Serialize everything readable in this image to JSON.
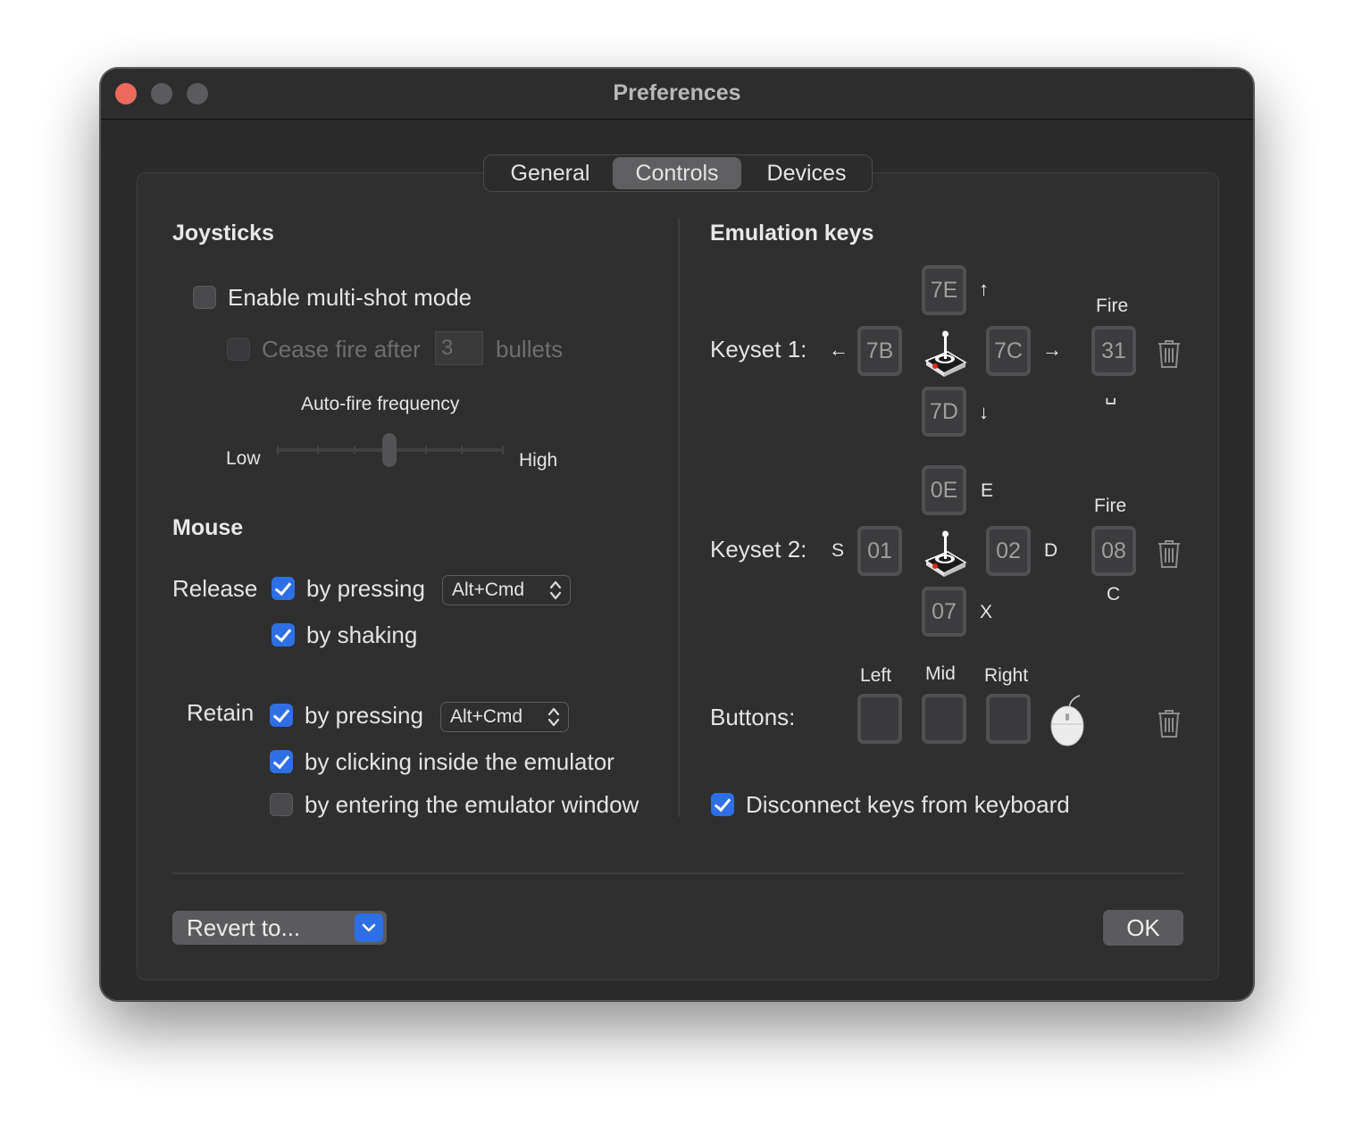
{
  "window": {
    "title": "Preferences"
  },
  "tabs": [
    {
      "label": "General",
      "selected": false
    },
    {
      "label": "Controls",
      "selected": true
    },
    {
      "label": "Devices",
      "selected": false
    }
  ],
  "joysticks": {
    "heading": "Joysticks",
    "multishot_label": "Enable multi-shot mode",
    "multishot_checked": false,
    "cease_fire_label": "Cease fire after",
    "cease_fire_value": "3",
    "bullets_label": "bullets",
    "autofire_label": "Auto-fire frequency",
    "low_label": "Low",
    "high_label": "High",
    "autofire_level_fraction": 0.5
  },
  "mouse": {
    "heading": "Mouse",
    "release_label": "Release",
    "release_pressing_label": "by pressing",
    "release_pressing_checked": true,
    "release_key": "Alt+Cmd",
    "release_shaking_label": "by shaking",
    "release_shaking_checked": true,
    "retain_label": "Retain",
    "retain_pressing_label": "by pressing",
    "retain_pressing_checked": true,
    "retain_key": "Alt+Cmd",
    "retain_clicking_label": "by clicking inside the emulator",
    "retain_clicking_checked": true,
    "retain_entering_label": "by entering the emulator window",
    "retain_entering_checked": false
  },
  "emulation": {
    "heading": "Emulation keys",
    "keyset1": {
      "label": "Keyset 1:",
      "up": "7E",
      "up_symbol": "↑",
      "left": "7B",
      "left_symbol": "←",
      "right": "7C",
      "right_symbol": "→",
      "down": "7D",
      "down_symbol": "↓",
      "fire_label": "Fire",
      "fire": "31",
      "fire_symbol": "␣"
    },
    "keyset2": {
      "label": "Keyset 2:",
      "up": "0E",
      "up_symbol": "E",
      "left": "01",
      "left_symbol": "S",
      "right": "02",
      "right_symbol": "D",
      "down": "07",
      "down_symbol": "X",
      "fire_label": "Fire",
      "fire": "08",
      "fire_symbol": "C"
    },
    "buttons": {
      "label": "Buttons:",
      "left_label": "Left",
      "mid_label": "Mid",
      "right_label": "Right"
    },
    "disconnect_label": "Disconnect keys from keyboard",
    "disconnect_checked": true
  },
  "footer": {
    "revert_label": "Revert to...",
    "ok_label": "OK"
  },
  "colors": {
    "accent": "#2f6fe4",
    "close": "#ed6a5e"
  }
}
